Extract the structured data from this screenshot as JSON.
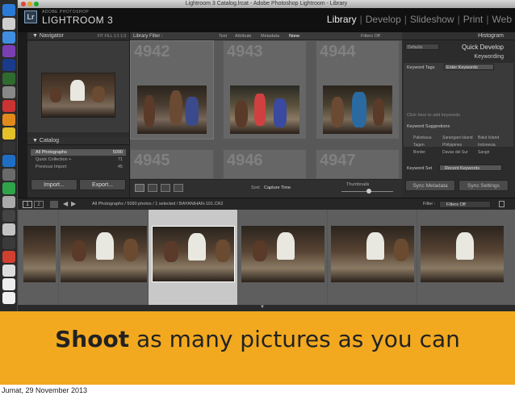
{
  "window": {
    "title": "Lightroom 3 Catalog.lrcat - Adobe Photoshop Lightroom - Library",
    "logo_small": "ADOBE PHOTOSHOP",
    "logo_big": "LIGHTROOM 3",
    "logo_badge": "Lr"
  },
  "modules": [
    "Library",
    "Develop",
    "Slideshow",
    "Print",
    "Web"
  ],
  "navigator": {
    "title": "Navigator",
    "zoom": [
      "FIT",
      "FILL",
      "1:1",
      "1:3"
    ]
  },
  "catalog": {
    "title": "Catalog",
    "items": [
      {
        "label": "All Photographs",
        "count": "5090"
      },
      {
        "label": "Quick Collection +",
        "count": "71"
      },
      {
        "label": "Previous Import",
        "count": "45"
      }
    ]
  },
  "buttons": {
    "import": "Import...",
    "export": "Export...",
    "sync_metadata": "Sync Metadata",
    "sync_settings": "Sync Settings"
  },
  "library_filter": {
    "label": "Library Filter :",
    "options": [
      "Text",
      "Attribute",
      "Metadata",
      "None"
    ],
    "filters_off": "Filters Off"
  },
  "grid": {
    "cell_numbers": [
      "4942",
      "4943",
      "4944",
      "4945",
      "4946",
      "4947"
    ]
  },
  "toolbar": {
    "sort_label": "Sort:",
    "sort_value": "Capture Time",
    "thumbnails": "Thumbnails"
  },
  "right_panel": {
    "histogram": "Histogram",
    "defaults": "Defaults",
    "quick_develop": "Quick Develop",
    "keywording": "Keywording",
    "keyword_tags": "Keyword Tags",
    "enter_keywords": "Enter Keywords",
    "click_here": "Click here to add keywords",
    "keyword_suggestions": "Keyword Suggestions",
    "suggestions": [
      "Pakebauu",
      "Sarangani Island",
      "Balut Island",
      "Tagen",
      "Philippines",
      "Indonesia",
      "Border",
      "Davao del Sur",
      "Sangir"
    ],
    "keyword_set": "Keyword Set",
    "recent_keywords": "Recent Keywords"
  },
  "filmstrip": {
    "pages": [
      "1",
      "2"
    ],
    "path": "All Photographs / 5090 photos / 1 selected / BAYANIHAN-101.CR2",
    "filter_label": "Filter :",
    "filter_value": "Filters Off"
  },
  "banner": {
    "strong": "Shoot",
    "rest": " as many pictures as you can"
  },
  "footer": {
    "date": "Jumat, 29 November 2013"
  },
  "colors": {
    "accent": "#f2a91f",
    "panel": "#2c2c2c",
    "grid": "#585858"
  }
}
